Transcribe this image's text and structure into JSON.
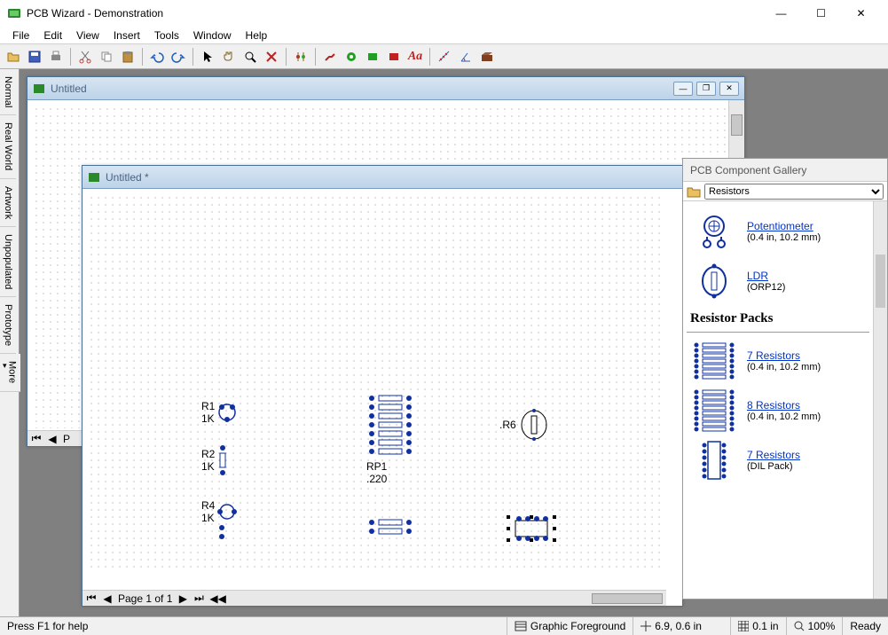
{
  "app": {
    "title": "PCB Wizard - Demonstration"
  },
  "menu": [
    "File",
    "Edit",
    "View",
    "Insert",
    "Tools",
    "Window",
    "Help"
  ],
  "sidetabs": [
    "Normal",
    "Real World",
    "Artwork",
    "Unpopulated",
    "Prototype",
    "More"
  ],
  "doc1": {
    "title": "Untitled",
    "page": "P"
  },
  "doc2": {
    "title": "Untitled *",
    "page": "Page 1 of 1"
  },
  "canvas": {
    "r1": {
      "ref": "R1",
      "val": "1K"
    },
    "r2": {
      "ref": "R2",
      "val": "1K"
    },
    "r4": {
      "ref": "R4",
      "val": "1K"
    },
    "rp1": {
      "ref": "RP1",
      "val": ".220"
    },
    "r6": {
      "ref": ".R6"
    }
  },
  "gallery": {
    "title": "PCB Component Gallery",
    "filter": "Resistors",
    "section": "Resistor Packs",
    "items": [
      {
        "name": "Potentiometer",
        "sub": "(0.4 in, 10.2 mm)"
      },
      {
        "name": "LDR",
        "sub": "(ORP12)"
      },
      {
        "name": "7 Resistors",
        "sub": "(0.4 in, 10.2 mm)"
      },
      {
        "name": "8 Resistors",
        "sub": "(0.4 in, 10.2 mm)"
      },
      {
        "name": "7 Resistors",
        "sub": "(DIL Pack)"
      }
    ]
  },
  "status": {
    "help": "Press F1 for help",
    "layer": "Graphic Foreground",
    "coord": "6.9, 0.6 in",
    "grid": "0.1 in",
    "zoom": "100%",
    "ready": "Ready"
  }
}
